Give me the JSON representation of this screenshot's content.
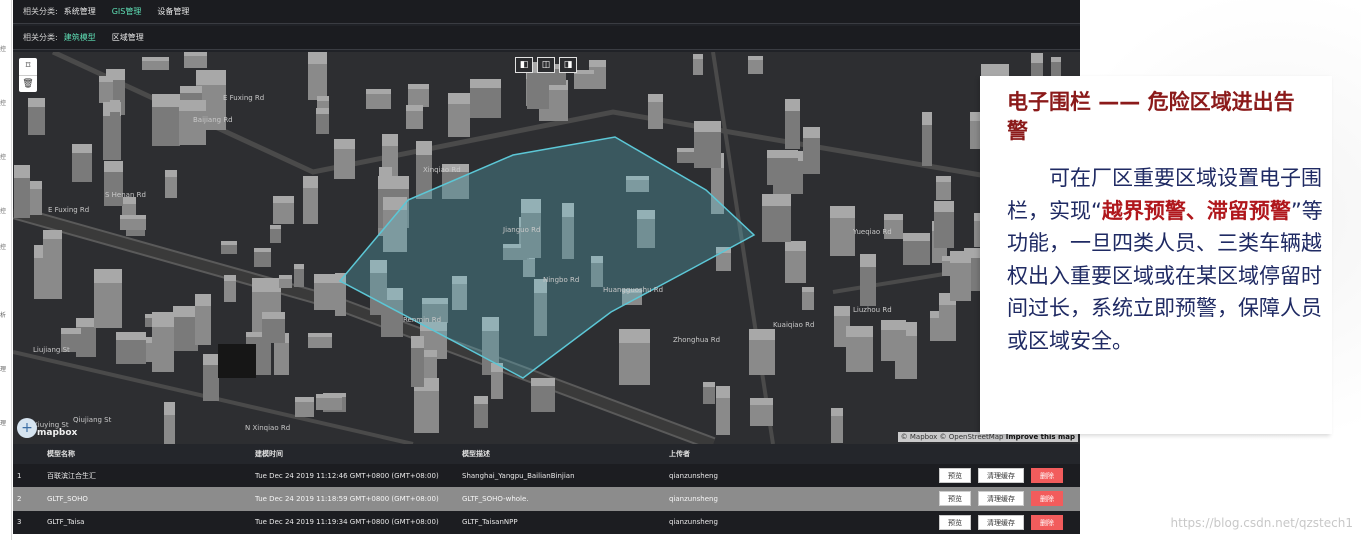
{
  "left_strip": {
    "marks": [
      "控",
      "控",
      "控",
      "控",
      "控",
      "析",
      "理",
      "理"
    ]
  },
  "top_nav": {
    "label": "相关分类:",
    "items": [
      {
        "label": "系统管理",
        "active": false
      },
      {
        "label": "GIS管理",
        "active": true
      },
      {
        "label": "设备管理",
        "active": false
      }
    ]
  },
  "sub_nav": {
    "label": "相关分类:",
    "items": [
      {
        "label": "建筑模型",
        "active": true
      },
      {
        "label": "区域管理",
        "active": false
      }
    ]
  },
  "map": {
    "draw_tools": {
      "polygon_icon": "⌑",
      "trash_icon": "🗑"
    },
    "view_buttons": [
      "◧",
      "◫",
      "◨"
    ],
    "zoom_label": "+",
    "logo_text": "mapbox",
    "attribution": "© Mapbox © OpenStreetMap",
    "attribution_link": "Improve this map",
    "street_labels": [
      "E Fuxing Rd",
      "S Henan Rd",
      "E Fuxing Rd",
      "Xinqiao Rd",
      "Zhonghua Rd",
      "Liujiang St",
      "Xiuying St",
      "N Xinqiao Rd",
      "Ningbo Rd",
      "Jianguo Rd",
      "Yueqiao Rd",
      "Kuaiqiao Rd",
      "Huangguoshu Rd",
      "Liuzhou Rd",
      "Renmin Rd",
      "Baijiang Rd",
      "Qiujiang St"
    ]
  },
  "table": {
    "headers": [
      "模型名称",
      "建模时间",
      "模型描述",
      "上传者"
    ],
    "rows": [
      {
        "index": "1",
        "name": "百联滨江合生汇",
        "time": "Tue Dec 24 2019 11:12:46 GMT+0800 (GMT+08:00)",
        "desc": "Shanghai_Yangpu_BailianBinjian",
        "uploader": "qianzunsheng"
      },
      {
        "index": "2",
        "name": "GLTF_SOHO",
        "time": "Tue Dec 24 2019 11:18:59 GMT+0800 (GMT+08:00)",
        "desc": "GLTF_SOHO-whole.",
        "uploader": "qianzunsheng"
      },
      {
        "index": "3",
        "name": "GLTF_Taisa",
        "time": "Tue Dec 24 2019 11:19:34 GMT+0800 (GMT+08:00)",
        "desc": "GLTF_TaisanNPP",
        "uploader": "qianzunsheng"
      }
    ],
    "actions": {
      "preview": "预览",
      "clear_cache": "清理缓存",
      "delete": "删除"
    }
  },
  "callout": {
    "title": "电子围栏 —— 危险区域进出告警",
    "body_prefix": "可在厂区重要区域设置电子围栏，实现“",
    "body_highlight": "越界预警、滞留预警",
    "body_suffix": "”等功能，一旦四类人员、三类车辆越权出入重要区域或在某区域停留时间过长，系统立即预警，保障人员或区域安全。"
  },
  "watermark": "https://blog.csdn.net/qzstech1",
  "colors": {
    "accent": "#5fe0b6",
    "fence": "#5cc7d6",
    "title_red": "#8b1a1a",
    "body_blue": "#1f2a63",
    "highlight_red": "#b0171c",
    "danger": "#f25c5c"
  }
}
